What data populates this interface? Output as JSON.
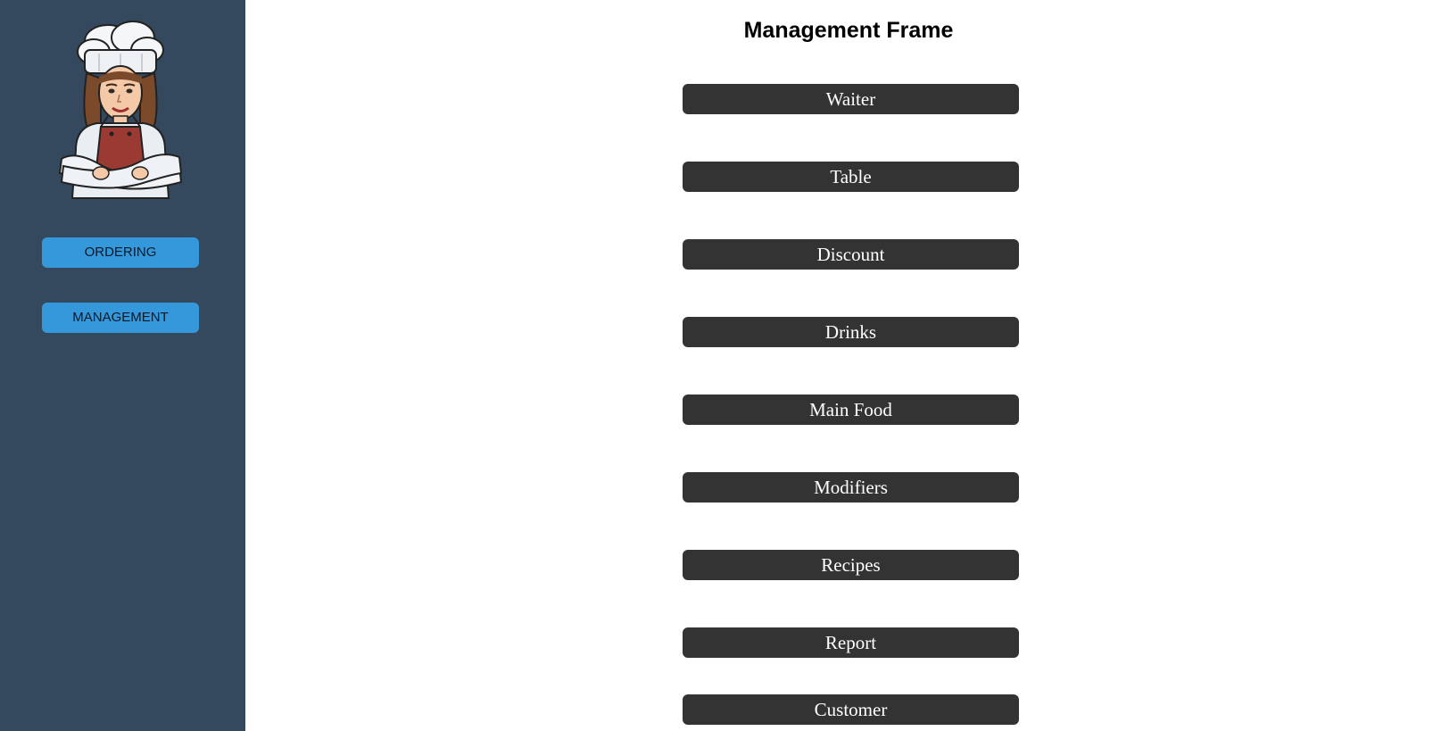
{
  "sidebar": {
    "avatar": "chef-avatar",
    "ordering_label": "ORDERING",
    "management_label": "MANAGEMENT",
    "background_color": "#34495e",
    "button_color": "#3498db"
  },
  "main": {
    "title": "Management Frame",
    "button_color": "#333333",
    "buttons": [
      {
        "label": "Waiter"
      },
      {
        "label": "Table"
      },
      {
        "label": "Discount"
      },
      {
        "label": "Drinks"
      },
      {
        "label": "Main Food"
      },
      {
        "label": "Modifiers"
      },
      {
        "label": "Recipes"
      },
      {
        "label": "Report"
      },
      {
        "label": "Customer"
      }
    ]
  }
}
